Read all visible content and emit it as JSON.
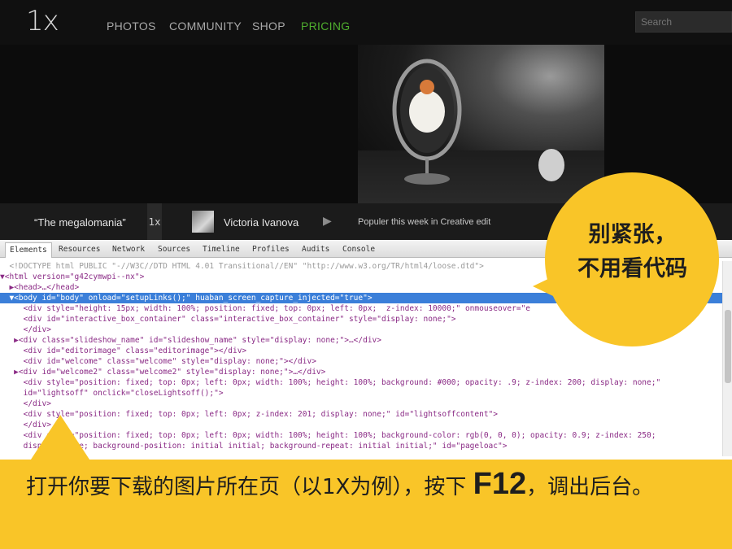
{
  "header": {
    "logo": "1x",
    "nav": [
      "PHOTOS",
      "COMMUNITY",
      "SHOP",
      "PRICING"
    ],
    "active_nav": "PRICING",
    "search_placeholder": "Search"
  },
  "caption_bar": {
    "photo_title": "“The megalomania”",
    "badge": "1x",
    "author": "Victoria Ivanova",
    "play_icon": "play-icon",
    "popular_text": "Populer this week in Creative edit"
  },
  "devtools": {
    "tabs": [
      "Elements",
      "Resources",
      "Network",
      "Sources",
      "Timeline",
      "Profiles",
      "Audits",
      "Console"
    ],
    "selected_tab": "Elements",
    "lines": [
      "  <!DOCTYPE html PUBLIC \"-//W3C//DTD HTML 4.01 Transitional//EN\" \"http://www.w3.org/TR/html4/loose.dtd\">",
      "▼<html version=\"g42cymwpi--nx\">",
      "  ▶<head>…</head>",
      "  ▼<body id=\"body\" onload=\"setupLinks();\" huaban_screen_capture_injected=\"true\">",
      "     <div style=\"height: 15px; width: 100%; position: fixed; top: 0px; left: 0px;  z-index: 10000;\" onmouseover=\"e",
      "     <div id=\"interactive_box_container\" class=\"interactive_box_container\" style=\"display: none;\">",
      "     </div>",
      "   ▶<div class=\"slideshow_name\" id=\"slideshow_name\" style=\"display: none;\">…</div>",
      "     <div id=\"editorimage\" class=\"editorimage\"></div>",
      "     <div id=\"welcome\" class=\"welcome\" style=\"display: none;\"></div>",
      "   ▶<div id=\"welcome2\" class=\"welcome2\" style=\"display: none;\">…</div>",
      "     <div style=\"position: fixed; top: 0px; left: 0px; width: 100%; height: 100%; background: #000; opacity: .9; z-index: 200; display: none;\"",
      "     id=\"lightsoff\" onclick=\"closeLightsoff();\">",
      "     </div>",
      "     <div style=\"position: fixed; top: 0px; left: 0px; z-index: 201; display: none;\" id=\"lightsoffcontent\">",
      "     </div>",
      "     <div style=\"position: fixed; top: 0px; left: 0px; width: 100%; height: 100%; background-color: rgb(0, 0, 0); opacity: 0.9; z-index: 250;",
      "     display: none; background-position: initial initial; background-repeat: initial initial;\" id=\"pageloac\">"
    ]
  },
  "callouts": {
    "bubble_line1": "别紧张，",
    "bubble_line2": "不用看代码",
    "banner_before": "打开你要下载的图片所在页（以1X为例），按下 ",
    "banner_key": "F12",
    "banner_after": "，调出后台。"
  },
  "colors": {
    "accent_green": "#4fae2e",
    "callout_yellow": "#f9c528",
    "selection_blue": "#3b7fd9"
  }
}
